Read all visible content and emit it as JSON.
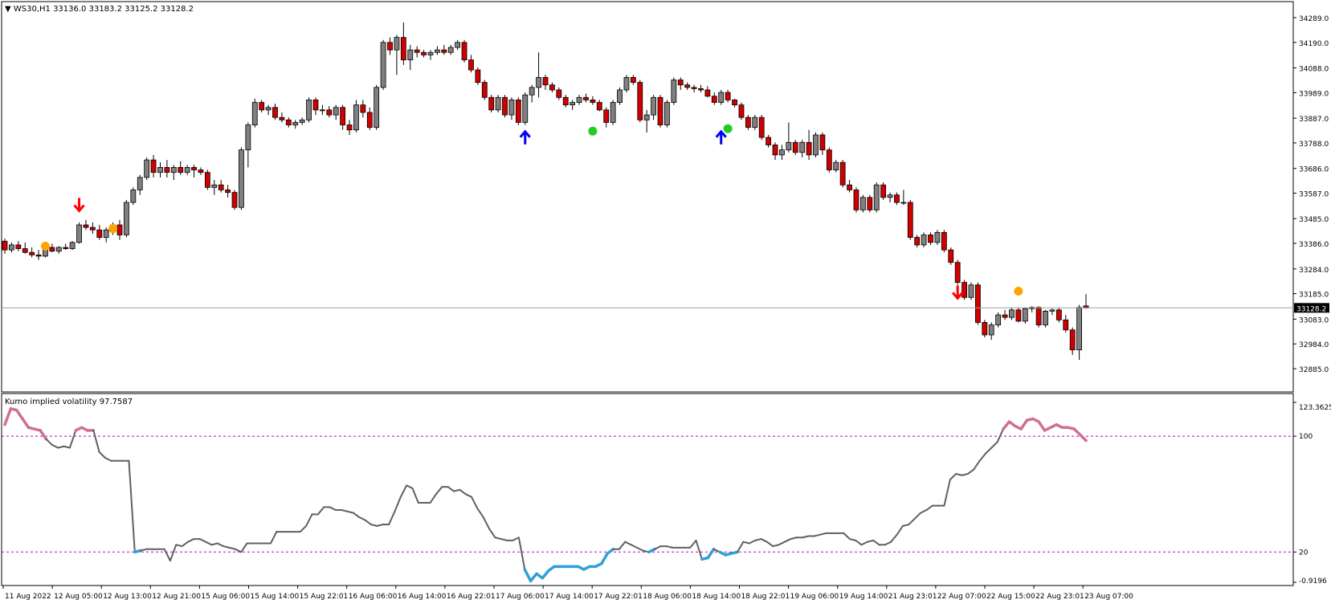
{
  "main": {
    "header": "▼ WS30,H1  33136.0 33183.2 33125.2 33128.2",
    "price_axis": [
      "34289.0",
      "34190.0",
      "34088.0",
      "33989.0",
      "33887.0",
      "33788.0",
      "33686.0",
      "33587.0",
      "33485.0",
      "33386.0",
      "33284.0",
      "33185.0",
      "33083.0",
      "32984.0",
      "32885.0"
    ],
    "current_price": "33128.2"
  },
  "indicator": {
    "header": "Kumo implied volatility 97.7587",
    "axis": [
      "123.3625",
      "100",
      "20",
      "-0.9196"
    ],
    "levels": [
      100,
      20
    ]
  },
  "time_axis": [
    "11 Aug 2022",
    "12 Aug 05:00",
    "12 Aug 13:00",
    "12 Aug 21:00",
    "15 Aug 06:00",
    "15 Aug 14:00",
    "15 Aug 22:01",
    "16 Aug 06:00",
    "16 Aug 14:00",
    "16 Aug 22:01",
    "17 Aug 06:00",
    "17 Aug 14:00",
    "17 Aug 22:01",
    "18 Aug 06:00",
    "18 Aug 14:00",
    "18 Aug 22:01",
    "19 Aug 06:00",
    "19 Aug 14:00",
    "21 Aug 23:01",
    "22 Aug 07:00",
    "22 Aug 15:00",
    "22 Aug 23:01",
    "23 Aug 07:00"
  ],
  "colors": {
    "bull": "#808080",
    "bear": "#d00000",
    "grid_line": "#c000c0",
    "vol_normal": "#606060",
    "vol_high": "#d07090",
    "vol_low": "#30a0d8",
    "up_arrow": "#0000ff",
    "down_arrow": "#ff0000",
    "orange_dot": "#ffa500",
    "green_dot": "#22cc22"
  },
  "chart_data": [
    {
      "type": "candlestick",
      "title": "WS30,H1",
      "ylim": [
        32885.0,
        34289.0
      ],
      "ohlc": [
        [
          33395,
          33405,
          33345,
          33360
        ],
        [
          33360,
          33390,
          33350,
          33380
        ],
        [
          33380,
          33395,
          33355,
          33365
        ],
        [
          33365,
          33390,
          33345,
          33350
        ],
        [
          33350,
          33370,
          33330,
          33340
        ],
        [
          33340,
          33360,
          33320,
          33335
        ],
        [
          33335,
          33380,
          33330,
          33370
        ],
        [
          33370,
          33385,
          33350,
          33355
        ],
        [
          33355,
          33375,
          33345,
          33370
        ],
        [
          33370,
          33385,
          33360,
          33365
        ],
        [
          33365,
          33395,
          33360,
          33390
        ],
        [
          33390,
          33470,
          33385,
          33460
        ],
        [
          33460,
          33480,
          33440,
          33450
        ],
        [
          33450,
          33470,
          33425,
          33440
        ],
        [
          33440,
          33460,
          33400,
          33410
        ],
        [
          33410,
          33450,
          33390,
          33440
        ],
        [
          33440,
          33470,
          33420,
          33460
        ],
        [
          33460,
          33480,
          33400,
          33420
        ],
        [
          33420,
          33560,
          33410,
          33550
        ],
        [
          33550,
          33610,
          33540,
          33600
        ],
        [
          33600,
          33660,
          33580,
          33650
        ],
        [
          33650,
          33730,
          33640,
          33720
        ],
        [
          33720,
          33740,
          33650,
          33670
        ],
        [
          33670,
          33710,
          33650,
          33690
        ],
        [
          33690,
          33720,
          33650,
          33670
        ],
        [
          33670,
          33700,
          33640,
          33690
        ],
        [
          33690,
          33715,
          33660,
          33670
        ],
        [
          33670,
          33700,
          33660,
          33690
        ],
        [
          33690,
          33700,
          33650,
          33680
        ],
        [
          33680,
          33690,
          33660,
          33670
        ],
        [
          33670,
          33680,
          33600,
          33610
        ],
        [
          33610,
          33640,
          33580,
          33620
        ],
        [
          33620,
          33640,
          33590,
          33600
        ],
        [
          33600,
          33620,
          33570,
          33590
        ],
        [
          33590,
          33600,
          33520,
          33530
        ],
        [
          33530,
          33770,
          33520,
          33760
        ],
        [
          33760,
          33870,
          33690,
          33860
        ],
        [
          33860,
          33965,
          33850,
          33950
        ],
        [
          33950,
          33960,
          33910,
          33920
        ],
        [
          33920,
          33940,
          33900,
          33930
        ],
        [
          33930,
          33945,
          33880,
          33890
        ],
        [
          33890,
          33910,
          33870,
          33880
        ],
        [
          33880,
          33890,
          33850,
          33860
        ],
        [
          33860,
          33880,
          33845,
          33870
        ],
        [
          33870,
          33890,
          33860,
          33880
        ],
        [
          33880,
          33970,
          33870,
          33960
        ],
        [
          33960,
          33970,
          33900,
          33920
        ],
        [
          33920,
          33940,
          33900,
          33920
        ],
        [
          33920,
          33935,
          33890,
          33900
        ],
        [
          33900,
          33940,
          33880,
          33930
        ],
        [
          33930,
          33940,
          33840,
          33860
        ],
        [
          33860,
          33880,
          33820,
          33840
        ],
        [
          33840,
          33960,
          33830,
          33940
        ],
        [
          33940,
          33960,
          33890,
          33910
        ],
        [
          33910,
          33930,
          33840,
          33850
        ],
        [
          33850,
          34020,
          33840,
          34010
        ],
        [
          34010,
          34200,
          34000,
          34190
        ],
        [
          34190,
          34210,
          34140,
          34160
        ],
        [
          34160,
          34220,
          34060,
          34210
        ],
        [
          34210,
          34270,
          34100,
          34120
        ],
        [
          34120,
          34180,
          34080,
          34160
        ],
        [
          34160,
          34175,
          34130,
          34150
        ],
        [
          34150,
          34160,
          34130,
          34140
        ],
        [
          34140,
          34160,
          34120,
          34150
        ],
        [
          34150,
          34175,
          34140,
          34160
        ],
        [
          34160,
          34180,
          34140,
          34150
        ],
        [
          34150,
          34180,
          34140,
          34170
        ],
        [
          34170,
          34200,
          34160,
          34190
        ],
        [
          34190,
          34200,
          34110,
          34120
        ],
        [
          34120,
          34140,
          34070,
          34080
        ],
        [
          34080,
          34090,
          34020,
          34030
        ],
        [
          34030,
          34040,
          33960,
          33970
        ],
        [
          33970,
          33980,
          33910,
          33920
        ],
        [
          33920,
          33980,
          33910,
          33970
        ],
        [
          33970,
          33980,
          33890,
          33900
        ],
        [
          33900,
          33970,
          33880,
          33960
        ],
        [
          33960,
          33970,
          33860,
          33870
        ],
        [
          33870,
          33990,
          33860,
          33980
        ],
        [
          33980,
          34020,
          33950,
          34010
        ],
        [
          34010,
          34150,
          33970,
          34050
        ],
        [
          34050,
          34060,
          34000,
          34020
        ],
        [
          34020,
          34030,
          33990,
          34000
        ],
        [
          34000,
          34010,
          33960,
          33970
        ],
        [
          33970,
          33980,
          33930,
          33940
        ],
        [
          33940,
          33960,
          33920,
          33950
        ],
        [
          33950,
          33980,
          33940,
          33970
        ],
        [
          33970,
          33985,
          33950,
          33960
        ],
        [
          33960,
          33975,
          33940,
          33950
        ],
        [
          33950,
          33960,
          33915,
          33920
        ],
        [
          33920,
          33930,
          33850,
          33870
        ],
        [
          33870,
          33960,
          33860,
          33950
        ],
        [
          33950,
          34010,
          33940,
          34000
        ],
        [
          34000,
          34060,
          33990,
          34050
        ],
        [
          34050,
          34060,
          34020,
          34030
        ],
        [
          34030,
          34040,
          33870,
          33880
        ],
        [
          33880,
          33920,
          33830,
          33900
        ],
        [
          33900,
          33980,
          33880,
          33970
        ],
        [
          33970,
          33980,
          33850,
          33860
        ],
        [
          33860,
          33960,
          33850,
          33950
        ],
        [
          33950,
          34050,
          33940,
          34040
        ],
        [
          34040,
          34050,
          34000,
          34020
        ],
        [
          34020,
          34030,
          34000,
          34010
        ],
        [
          34010,
          34020,
          33990,
          34005
        ],
        [
          34005,
          34020,
          33990,
          34000
        ],
        [
          34000,
          34015,
          33970,
          33975
        ],
        [
          33975,
          33990,
          33940,
          33950
        ],
        [
          33950,
          34000,
          33940,
          33990
        ],
        [
          33990,
          34000,
          33950,
          33960
        ],
        [
          33960,
          33965,
          33930,
          33940
        ],
        [
          33940,
          33950,
          33880,
          33890
        ],
        [
          33890,
          33900,
          33840,
          33850
        ],
        [
          33850,
          33900,
          33840,
          33890
        ],
        [
          33890,
          33900,
          33800,
          33810
        ],
        [
          33810,
          33820,
          33770,
          33780
        ],
        [
          33780,
          33790,
          33720,
          33740
        ],
        [
          33740,
          33780,
          33720,
          33760
        ],
        [
          33760,
          33870,
          33750,
          33790
        ],
        [
          33790,
          33800,
          33740,
          33750
        ],
        [
          33750,
          33800,
          33730,
          33790
        ],
        [
          33790,
          33840,
          33720,
          33740
        ],
        [
          33740,
          33830,
          33730,
          33820
        ],
        [
          33820,
          33830,
          33740,
          33760
        ],
        [
          33760,
          33770,
          33670,
          33680
        ],
        [
          33680,
          33720,
          33670,
          33710
        ],
        [
          33710,
          33720,
          33610,
          33620
        ],
        [
          33620,
          33640,
          33590,
          33600
        ],
        [
          33600,
          33610,
          33510,
          33520
        ],
        [
          33520,
          33580,
          33510,
          33570
        ],
        [
          33570,
          33580,
          33510,
          33520
        ],
        [
          33520,
          33630,
          33510,
          33620
        ],
        [
          33620,
          33630,
          33560,
          33570
        ],
        [
          33570,
          33590,
          33550,
          33580
        ],
        [
          33580,
          33590,
          33540,
          33550
        ],
        [
          33550,
          33600,
          33540,
          33550
        ],
        [
          33550,
          33560,
          33400,
          33410
        ],
        [
          33410,
          33420,
          33370,
          33380
        ],
        [
          33380,
          33430,
          33370,
          33420
        ],
        [
          33420,
          33430,
          33380,
          33390
        ],
        [
          33390,
          33440,
          33380,
          33430
        ],
        [
          33430,
          33440,
          33350,
          33360
        ],
        [
          33360,
          33370,
          33300,
          33310
        ],
        [
          33310,
          33320,
          33220,
          33230
        ],
        [
          33230,
          33240,
          33160,
          33170
        ],
        [
          33170,
          33230,
          33160,
          33220
        ],
        [
          33220,
          33230,
          33060,
          33070
        ],
        [
          33070,
          33080,
          33010,
          33020
        ],
        [
          33020,
          33070,
          33000,
          33060
        ],
        [
          33060,
          33110,
          33050,
          33100
        ],
        [
          33100,
          33120,
          33080,
          33090
        ],
        [
          33090,
          33130,
          33080,
          33120
        ],
        [
          33120,
          33130,
          33070,
          33075
        ],
        [
          33075,
          33130,
          33065,
          33125
        ],
        [
          33125,
          33135,
          33110,
          33130
        ],
        [
          33130,
          33135,
          33050,
          33060
        ],
        [
          33060,
          33120,
          33050,
          33115
        ],
        [
          33115,
          33125,
          33100,
          33120
        ],
        [
          33120,
          33130,
          33070,
          33080
        ],
        [
          33080,
          33100,
          33030,
          33040
        ],
        [
          33040,
          33050,
          32940,
          32960
        ],
        [
          32960,
          33140,
          32920,
          33130
        ],
        [
          33136,
          33183,
          33125,
          33128
        ]
      ],
      "signals": [
        {
          "kind": "down_arrow",
          "bar": 11,
          "price": 33510
        },
        {
          "kind": "orange_dot",
          "bar": 6,
          "price": 33375
        },
        {
          "kind": "orange_dot",
          "bar": 16,
          "price": 33445
        },
        {
          "kind": "up_arrow",
          "bar": 77,
          "price": 33840
        },
        {
          "kind": "green_dot",
          "bar": 87,
          "price": 33835
        },
        {
          "kind": "up_arrow",
          "bar": 106,
          "price": 33840
        },
        {
          "kind": "green_dot",
          "bar": 107,
          "price": 33845
        },
        {
          "kind": "down_arrow",
          "bar": 141,
          "price": 33160
        },
        {
          "kind": "orange_dot",
          "bar": 150,
          "price": 33195
        }
      ]
    },
    {
      "type": "line",
      "title": "Kumo implied volatility",
      "ylim": [
        -0.9196,
        123.3625
      ],
      "levels": [
        100,
        20
      ],
      "values": [
        108,
        119,
        118,
        112,
        106,
        105,
        104,
        98,
        94,
        92,
        93,
        92,
        104,
        106,
        104,
        104,
        89,
        85,
        83,
        83,
        83,
        83,
        20,
        21,
        22,
        22,
        22,
        22,
        14,
        25,
        24,
        27,
        29,
        29,
        27,
        25,
        26,
        24,
        23,
        22,
        20,
        26,
        26,
        26,
        26,
        26,
        34,
        34,
        34,
        34,
        34,
        38,
        46,
        46,
        51,
        51,
        49,
        49,
        48,
        47,
        44,
        42,
        39,
        38,
        39,
        39,
        48,
        58,
        66,
        64,
        54,
        54,
        54,
        60,
        65,
        65,
        62,
        63,
        60,
        58,
        50,
        44,
        36,
        30,
        29,
        28,
        28,
        30,
        8,
        0,
        5,
        2,
        7,
        10,
        10,
        10,
        10,
        10,
        8,
        10,
        10,
        12,
        19,
        22,
        22,
        27,
        25,
        23,
        21,
        20,
        22,
        24,
        24,
        23,
        23,
        23,
        23,
        28,
        15,
        16,
        22,
        20,
        18,
        19,
        20,
        27,
        26,
        28,
        29,
        27,
        24,
        25,
        27,
        29,
        30,
        30,
        31,
        31,
        32,
        33,
        33,
        33,
        33,
        29,
        28,
        25,
        27,
        28,
        25,
        25,
        27,
        32,
        38,
        39,
        43,
        47,
        49,
        52,
        52,
        52,
        70,
        74,
        73,
        74,
        77,
        83,
        88,
        92,
        96,
        105,
        110,
        107,
        105,
        111,
        112,
        110,
        104,
        106,
        108,
        106,
        106,
        105,
        101,
        97
      ],
      "high_color_above": 100,
      "low_color_below": 20
    }
  ]
}
